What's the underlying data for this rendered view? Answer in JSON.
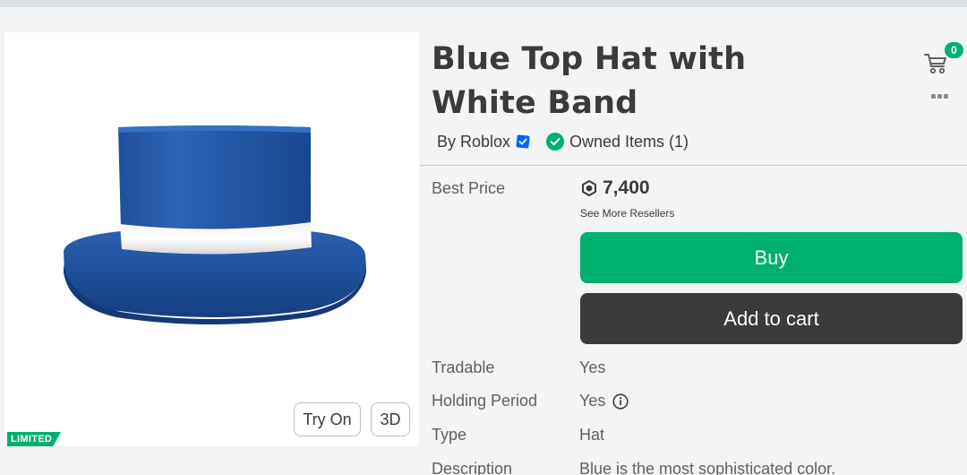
{
  "item": {
    "title": "Blue Top Hat with White Band",
    "by_prefix": "By",
    "creator": "Roblox",
    "owned_text": "Owned Items (1)",
    "limited_badge": "LIMITED"
  },
  "viewer": {
    "try_on_label": "Try On",
    "three_d_label": "3D"
  },
  "header": {
    "cart_count": "0"
  },
  "purchase": {
    "best_price_label": "Best Price",
    "price": "7,400",
    "see_more": "See More Resellers",
    "buy_label": "Buy",
    "add_to_cart_label": "Add to cart"
  },
  "details": [
    {
      "label": "Tradable",
      "value": "Yes"
    },
    {
      "label": "Holding Period",
      "value": "Yes"
    },
    {
      "label": "Type",
      "value": "Hat"
    },
    {
      "label": "Description",
      "value": "Blue is the most sophisticated color."
    }
  ],
  "colors": {
    "accent_green": "#00b06f",
    "dark_button": "#393b3d",
    "verified_blue": "#0066ff"
  },
  "icons": [
    "cart-icon",
    "more-icon",
    "verified-icon",
    "check-circle-icon",
    "robux-icon",
    "info-icon"
  ]
}
